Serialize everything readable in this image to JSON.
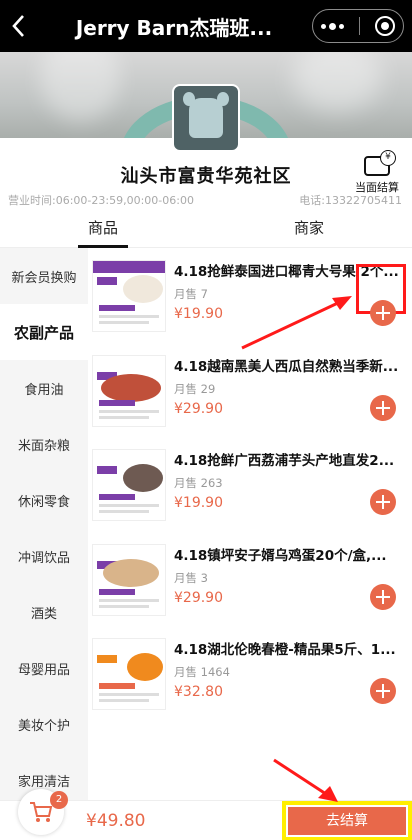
{
  "header": {
    "title": "Jerry Barn杰瑞班...",
    "back_icon": "back-arrow-icon",
    "more_icon": "more-dots-icon",
    "close_icon": "target-circle-icon"
  },
  "shop": {
    "name": "汕头市富贵华苑社区",
    "hours": "营业时间:06:00-23:59,00:00-06:00",
    "phone": "电话:13322705411",
    "checkout_label": "当面结算"
  },
  "tabs": [
    {
      "label": "商品",
      "active": true
    },
    {
      "label": "商家",
      "active": false
    }
  ],
  "sidebar": {
    "items": [
      {
        "label": "新会员换购",
        "active": false
      },
      {
        "label": "农副产品",
        "active": true
      },
      {
        "label": "食用油",
        "active": false
      },
      {
        "label": "米面杂粮",
        "active": false
      },
      {
        "label": "休闲零食",
        "active": false
      },
      {
        "label": "冲调饮品",
        "active": false
      },
      {
        "label": "酒类",
        "active": false
      },
      {
        "label": "母婴用品",
        "active": false
      },
      {
        "label": "美妆个护",
        "active": false
      },
      {
        "label": "家用清洁",
        "active": false
      }
    ]
  },
  "products": [
    {
      "name": "4.18抢鲜泰国进口椰青大号果 2个...",
      "sold": "月售 7",
      "price": "¥19.90",
      "pic_color": "#f0e8dc"
    },
    {
      "name": "4.18越南黑美人西瓜自然熟当季新...",
      "sold": "月售 29",
      "price": "¥29.90",
      "pic_color": "#c0503a"
    },
    {
      "name": "4.18抢鲜广西荔浦芋头产地直发2...",
      "sold": "月售 263",
      "price": "¥19.90",
      "pic_color": "#6e5a52"
    },
    {
      "name": "4.18镇坪安子婿乌鸡蛋20个/盒,...",
      "sold": "月售 3",
      "price": "¥29.90",
      "pic_color": "#d9b48a"
    },
    {
      "name": "4.18湖北伦晚春橙-精品果5斤、1...",
      "sold": "月售 1464",
      "price": "¥32.80",
      "pic_color": "#f08a1e"
    }
  ],
  "cart": {
    "badge": "2",
    "total": "¥49.80",
    "checkout_label": "去结算"
  },
  "colors": {
    "accent": "#e8684a",
    "highlight_red": "#ff1a1a",
    "highlight_yellow": "#ffee00"
  }
}
